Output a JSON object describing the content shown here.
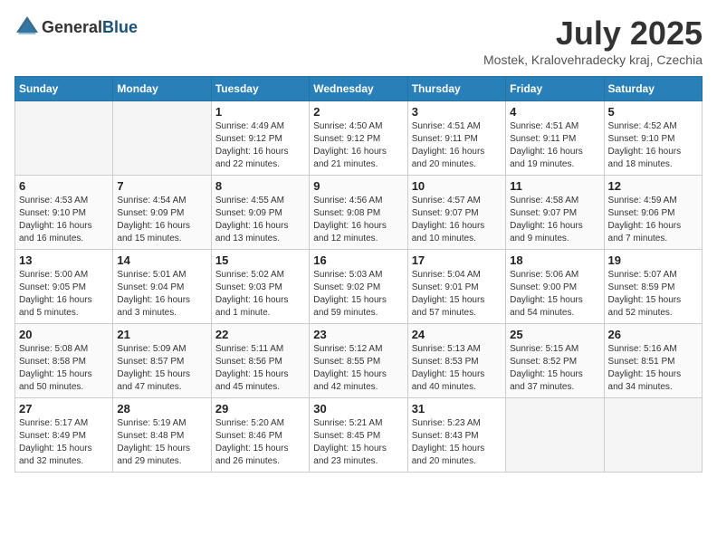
{
  "header": {
    "logo_general": "General",
    "logo_blue": "Blue",
    "month_year": "July 2025",
    "location": "Mostek, Kralovehradecky kraj, Czechia"
  },
  "weekdays": [
    "Sunday",
    "Monday",
    "Tuesday",
    "Wednesday",
    "Thursday",
    "Friday",
    "Saturday"
  ],
  "weeks": [
    [
      {
        "day": "",
        "info": ""
      },
      {
        "day": "",
        "info": ""
      },
      {
        "day": "1",
        "info": "Sunrise: 4:49 AM\nSunset: 9:12 PM\nDaylight: 16 hours and 22 minutes."
      },
      {
        "day": "2",
        "info": "Sunrise: 4:50 AM\nSunset: 9:12 PM\nDaylight: 16 hours and 21 minutes."
      },
      {
        "day": "3",
        "info": "Sunrise: 4:51 AM\nSunset: 9:11 PM\nDaylight: 16 hours and 20 minutes."
      },
      {
        "day": "4",
        "info": "Sunrise: 4:51 AM\nSunset: 9:11 PM\nDaylight: 16 hours and 19 minutes."
      },
      {
        "day": "5",
        "info": "Sunrise: 4:52 AM\nSunset: 9:10 PM\nDaylight: 16 hours and 18 minutes."
      }
    ],
    [
      {
        "day": "6",
        "info": "Sunrise: 4:53 AM\nSunset: 9:10 PM\nDaylight: 16 hours and 16 minutes."
      },
      {
        "day": "7",
        "info": "Sunrise: 4:54 AM\nSunset: 9:09 PM\nDaylight: 16 hours and 15 minutes."
      },
      {
        "day": "8",
        "info": "Sunrise: 4:55 AM\nSunset: 9:09 PM\nDaylight: 16 hours and 13 minutes."
      },
      {
        "day": "9",
        "info": "Sunrise: 4:56 AM\nSunset: 9:08 PM\nDaylight: 16 hours and 12 minutes."
      },
      {
        "day": "10",
        "info": "Sunrise: 4:57 AM\nSunset: 9:07 PM\nDaylight: 16 hours and 10 minutes."
      },
      {
        "day": "11",
        "info": "Sunrise: 4:58 AM\nSunset: 9:07 PM\nDaylight: 16 hours and 9 minutes."
      },
      {
        "day": "12",
        "info": "Sunrise: 4:59 AM\nSunset: 9:06 PM\nDaylight: 16 hours and 7 minutes."
      }
    ],
    [
      {
        "day": "13",
        "info": "Sunrise: 5:00 AM\nSunset: 9:05 PM\nDaylight: 16 hours and 5 minutes."
      },
      {
        "day": "14",
        "info": "Sunrise: 5:01 AM\nSunset: 9:04 PM\nDaylight: 16 hours and 3 minutes."
      },
      {
        "day": "15",
        "info": "Sunrise: 5:02 AM\nSunset: 9:03 PM\nDaylight: 16 hours and 1 minute."
      },
      {
        "day": "16",
        "info": "Sunrise: 5:03 AM\nSunset: 9:02 PM\nDaylight: 15 hours and 59 minutes."
      },
      {
        "day": "17",
        "info": "Sunrise: 5:04 AM\nSunset: 9:01 PM\nDaylight: 15 hours and 57 minutes."
      },
      {
        "day": "18",
        "info": "Sunrise: 5:06 AM\nSunset: 9:00 PM\nDaylight: 15 hours and 54 minutes."
      },
      {
        "day": "19",
        "info": "Sunrise: 5:07 AM\nSunset: 8:59 PM\nDaylight: 15 hours and 52 minutes."
      }
    ],
    [
      {
        "day": "20",
        "info": "Sunrise: 5:08 AM\nSunset: 8:58 PM\nDaylight: 15 hours and 50 minutes."
      },
      {
        "day": "21",
        "info": "Sunrise: 5:09 AM\nSunset: 8:57 PM\nDaylight: 15 hours and 47 minutes."
      },
      {
        "day": "22",
        "info": "Sunrise: 5:11 AM\nSunset: 8:56 PM\nDaylight: 15 hours and 45 minutes."
      },
      {
        "day": "23",
        "info": "Sunrise: 5:12 AM\nSunset: 8:55 PM\nDaylight: 15 hours and 42 minutes."
      },
      {
        "day": "24",
        "info": "Sunrise: 5:13 AM\nSunset: 8:53 PM\nDaylight: 15 hours and 40 minutes."
      },
      {
        "day": "25",
        "info": "Sunrise: 5:15 AM\nSunset: 8:52 PM\nDaylight: 15 hours and 37 minutes."
      },
      {
        "day": "26",
        "info": "Sunrise: 5:16 AM\nSunset: 8:51 PM\nDaylight: 15 hours and 34 minutes."
      }
    ],
    [
      {
        "day": "27",
        "info": "Sunrise: 5:17 AM\nSunset: 8:49 PM\nDaylight: 15 hours and 32 minutes."
      },
      {
        "day": "28",
        "info": "Sunrise: 5:19 AM\nSunset: 8:48 PM\nDaylight: 15 hours and 29 minutes."
      },
      {
        "day": "29",
        "info": "Sunrise: 5:20 AM\nSunset: 8:46 PM\nDaylight: 15 hours and 26 minutes."
      },
      {
        "day": "30",
        "info": "Sunrise: 5:21 AM\nSunset: 8:45 PM\nDaylight: 15 hours and 23 minutes."
      },
      {
        "day": "31",
        "info": "Sunrise: 5:23 AM\nSunset: 8:43 PM\nDaylight: 15 hours and 20 minutes."
      },
      {
        "day": "",
        "info": ""
      },
      {
        "day": "",
        "info": ""
      }
    ]
  ]
}
